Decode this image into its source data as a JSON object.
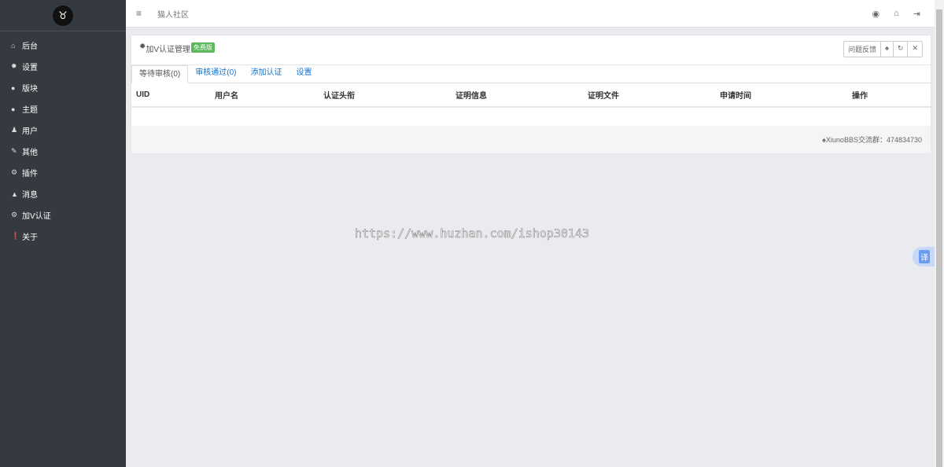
{
  "sidebar": {
    "items": [
      {
        "label": "后台",
        "icon": "home-icon",
        "glyph": "⌂"
      },
      {
        "label": "设置",
        "icon": "gear-icon",
        "glyph": "✹"
      },
      {
        "label": "版块",
        "icon": "comment-icon",
        "glyph": "●"
      },
      {
        "label": "主题",
        "icon": "comment-icon",
        "glyph": "●"
      },
      {
        "label": "用户",
        "icon": "user-icon",
        "glyph": "♟"
      },
      {
        "label": "其他",
        "icon": "wrench-icon",
        "glyph": "✎"
      },
      {
        "label": "插件",
        "icon": "cogs-icon",
        "glyph": "⚙"
      },
      {
        "label": "消息",
        "icon": "bell-icon",
        "glyph": "▲"
      },
      {
        "label": "加V认证",
        "icon": "cogs-icon",
        "glyph": "⚙"
      },
      {
        "label": "关于",
        "icon": "info-icon",
        "glyph": "❗"
      }
    ]
  },
  "header": {
    "site_title": "猫人社区"
  },
  "card": {
    "title": "加V认证管理",
    "badge": "免费版",
    "feedback": "问题反馈",
    "tabs": [
      "等待审核(0)",
      "审核通过(0)",
      "添加认证",
      "设置"
    ],
    "columns": [
      "UID",
      "用户名",
      "认证头衔",
      "证明信息",
      "证明文件",
      "申请时间",
      "操作"
    ],
    "footer": "XiunoBBS交流群：474834730"
  },
  "watermark": "https://www.huzhan.com/ishop30143",
  "translate": "译"
}
